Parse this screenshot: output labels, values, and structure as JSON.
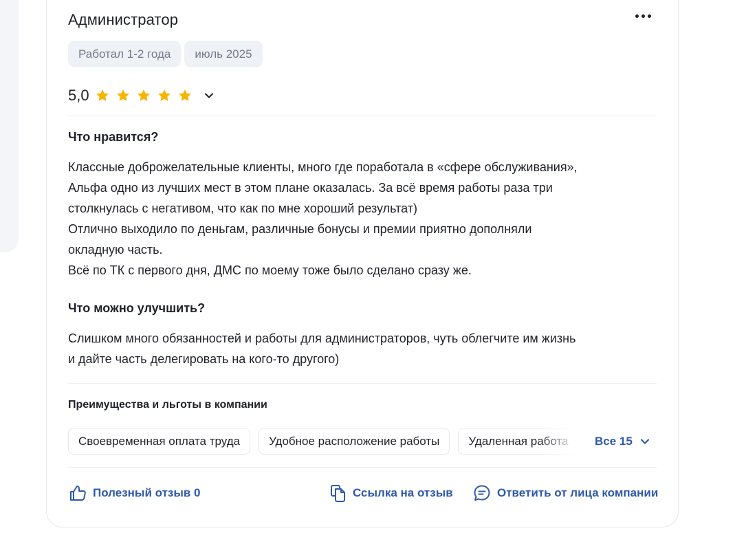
{
  "review": {
    "title": "Администратор",
    "chips": [
      "Работал 1-2 года",
      "июль 2025"
    ],
    "rating": "5,0",
    "stars": 5,
    "likes_title": "Что нравится?",
    "likes_lines": [
      "Классные доброжелательные клиенты, много где поработала в «сфере обслуживания»,",
      "Альфа одно из лучших мест в этом плане оказалась. За всё время работы раза три",
      "столкнулась с негативом, что как по мне хороший результат)",
      "Отлично выходило по деньгам, различные бонусы и премии приятно дополняли",
      "окладную часть.",
      "Всё по ТК с первого дня, ДМС по моему тоже было сделано сразу же."
    ],
    "improve_title": "Что можно улучшить?",
    "improve_lines": [
      "Слишком много обязанностей и работы для администраторов, чуть облегчите им жизнь",
      "и дайте часть делегировать на кого-то другого)"
    ]
  },
  "benefits": {
    "title": "Преимущества и льготы в компании",
    "items": [
      "Своевременная оплата труда",
      "Удобное расположение работы",
      "Удаленная работа"
    ],
    "all_label": "Все 15"
  },
  "actions": {
    "helpful": "Полезный отзыв 0",
    "link": "Ссылка на отзыв",
    "reply": "Ответить от лица компании"
  },
  "colors": {
    "accent": "#2e5aa8",
    "star": "#f7b500",
    "chip_bg": "#eef1f6"
  }
}
